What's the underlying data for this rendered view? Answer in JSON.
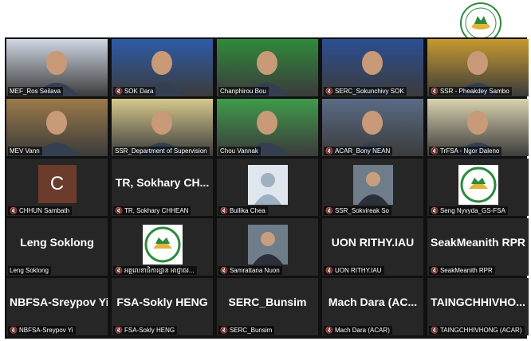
{
  "logo": {
    "text": "TRUST REGULATOR",
    "icon": "trust-regulator-logo"
  },
  "participants": [
    {
      "name": "MEF_Ros Seilava",
      "display": "",
      "muted": false,
      "kind": "video",
      "speaker": true,
      "bg": "#cfd7e3"
    },
    {
      "name": "SOK Dara",
      "display": "",
      "muted": true,
      "kind": "video",
      "bg": "#2d5ba8"
    },
    {
      "name": "Chanphirou Bou",
      "display": "",
      "muted": false,
      "kind": "video",
      "bg": "#2f8a3b"
    },
    {
      "name": "SERC_Sokunchivy SOK",
      "display": "",
      "muted": true,
      "kind": "video",
      "bg": "#2b4f93"
    },
    {
      "name": "SSR - Pheakdey Sambo",
      "display": "",
      "muted": true,
      "kind": "video",
      "bg": "#c79a2f"
    },
    {
      "name": "MEV Vann",
      "display": "",
      "muted": false,
      "kind": "video",
      "bg": "#9b7a4a"
    },
    {
      "name": "SSR_Department of Supervision",
      "display": "",
      "muted": false,
      "kind": "video",
      "bg": "#d6c88c"
    },
    {
      "name": "Chou Vannak",
      "display": "",
      "muted": false,
      "kind": "video",
      "bg": "#3f9a4a"
    },
    {
      "name": "ACAR_Bony NEAN",
      "display": "",
      "muted": true,
      "kind": "video",
      "bg": "#5a6b85"
    },
    {
      "name": "TrFSA - Ngor Daleno",
      "display": "",
      "muted": true,
      "kind": "video",
      "bg": "#d9d2b0"
    },
    {
      "name": "CHHUN Sambath",
      "display": "C",
      "muted": true,
      "kind": "letter"
    },
    {
      "name": "TR, Sokhary CHHEAN",
      "display": "TR, Sokhary CH...",
      "muted": true,
      "kind": "text"
    },
    {
      "name": "Bullika Chea",
      "display": "",
      "muted": true,
      "kind": "avatar"
    },
    {
      "name": "SSR_Sokvireak So",
      "display": "",
      "muted": true,
      "kind": "photo"
    },
    {
      "name": "Seng Nyvyda_GS-FSA",
      "display": "",
      "muted": true,
      "kind": "logo"
    },
    {
      "name": "Leng Soklong",
      "display": "Leng Soklong",
      "muted": false,
      "kind": "text"
    },
    {
      "name": "អគ្គលេខាធិការដ្ឋាន អាជ្ញាធរ...",
      "display": "",
      "muted": true,
      "kind": "logo"
    },
    {
      "name": "Samrattana Nuon",
      "display": "",
      "muted": true,
      "kind": "photo"
    },
    {
      "name": "UON RITHY.IAU",
      "display": "UON RITHY.IAU",
      "muted": true,
      "kind": "text"
    },
    {
      "name": "SeakMeanith RPR",
      "display": "SeakMeanith RPR",
      "muted": true,
      "kind": "text"
    },
    {
      "name": "NBFSA-Sreypov Yi",
      "display": "NBFSA-Sreypov Yi",
      "muted": true,
      "kind": "text"
    },
    {
      "name": "FSA-Sokly HENG",
      "display": "FSA-Sokly HENG",
      "muted": true,
      "kind": "text"
    },
    {
      "name": "SERC_Bunsim",
      "display": "SERC_Bunsim",
      "muted": true,
      "kind": "text"
    },
    {
      "name": "Mach Dara (ACAR)",
      "display": "Mach Dara (AC...",
      "muted": true,
      "kind": "text"
    },
    {
      "name": "TAINGCHHIVHONG (ACAR)",
      "display": "TAINGCHHIVHO...",
      "muted": true,
      "kind": "text"
    }
  ],
  "colors": {
    "tile": "#262626",
    "speaker_border": "#d8e63a",
    "muted_icon": "#e5322d",
    "letter_avatar": "#6b3b2c"
  }
}
